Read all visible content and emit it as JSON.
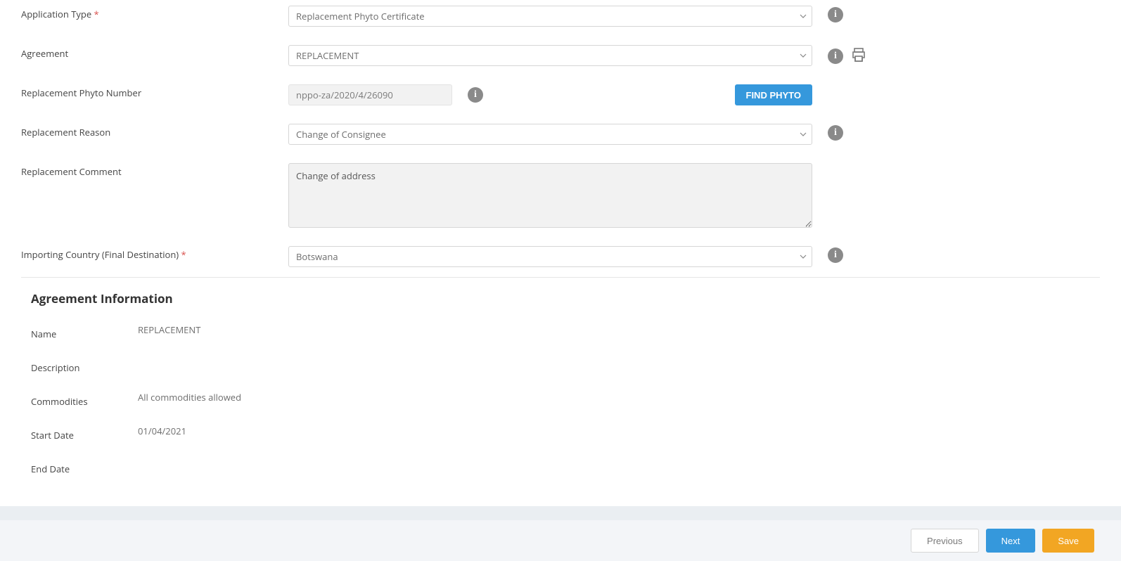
{
  "form": {
    "app_type": {
      "label": "Application Type",
      "value": "Replacement Phyto Certificate"
    },
    "agreement": {
      "label": "Agreement",
      "value": "REPLACEMENT"
    },
    "phyto_number": {
      "label": "Replacement Phyto Number",
      "value": "nppo-za/2020/4/26090",
      "find_btn": "FIND PHYTO"
    },
    "reason": {
      "label": "Replacement Reason",
      "value": "Change of Consignee"
    },
    "comment": {
      "label": "Replacement Comment",
      "value": "Change of address"
    },
    "country": {
      "label": "Importing Country (Final Destination)",
      "value": "Botswana"
    }
  },
  "agreement_section": {
    "title": "Agreement Information",
    "rows": {
      "name": {
        "label": "Name",
        "value": "REPLACEMENT"
      },
      "description": {
        "label": "Description",
        "value": ""
      },
      "commodities": {
        "label": "Commodities",
        "value": "All commodities allowed"
      },
      "start_date": {
        "label": "Start Date",
        "value": "01/04/2021"
      },
      "end_date": {
        "label": "End Date",
        "value": ""
      }
    }
  },
  "footer": {
    "previous": "Previous",
    "next": "Next",
    "save": "Save"
  }
}
